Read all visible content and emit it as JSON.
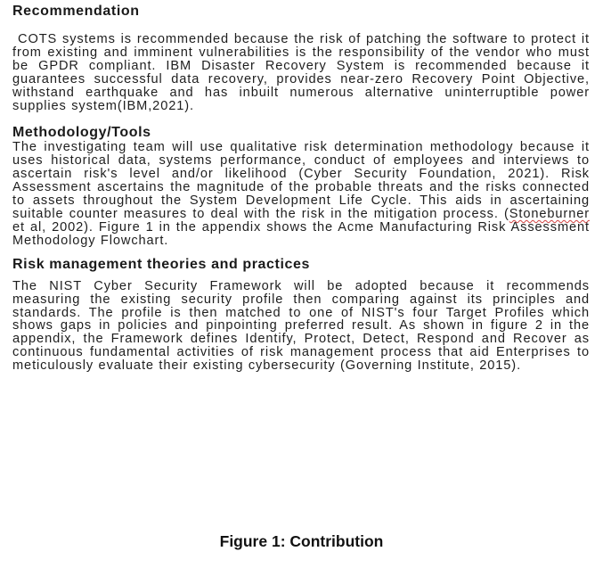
{
  "sections": [
    {
      "heading": "Recommendation",
      "paragraph": "COTS systems is recommended because the risk of patching the software to protect it from existing and imminent vulnerabilities is the responsibility of the vendor who must be GPDR compliant. IBM Disaster Recovery System is recommended because it guarantees successful data recovery, provides near-zero Recovery Point Objective, withstand earthquake and has inbuilt numerous alternative uninterruptible power supplies system(IBM,2021)."
    },
    {
      "heading": "Methodology/Tools",
      "paragraph_before": "The investigating team will use qualitative risk determination methodology because it uses historical data, systems performance, conduct of employees and interviews to ascertain risk's level and/or likelihood (Cyber Security Foundation, 2021). Risk Assessment ascertains the magnitude of the probable threats and the risks connected to assets throughout the System Development Life Cycle. This aids in ascertaining suitable counter measures to deal with the risk in the mitigation process. (",
      "underlined": "Stoneburner",
      "paragraph_after": " et al, 2002). Figure 1 in the appendix shows the Acme Manufacturing Risk Assessment Methodology Flowchart."
    },
    {
      "heading": "Risk management theories and practices",
      "paragraph": "The NIST Cyber Security Framework will be adopted because it recommends measuring the existing security profile then comparing against its principles and standards. The profile is then matched to one of NIST's four Target Profiles which shows gaps in policies and pinpointing preferred result. As shown in figure 2 in the appendix, the Framework defines Identify, Protect, Detect, Respond and Recover as continuous fundamental activities of risk management process that aid Enterprises to meticulously evaluate their existing cybersecurity (Governing Institute, 2015)."
    }
  ],
  "caption": "Figure 1: Contribution"
}
